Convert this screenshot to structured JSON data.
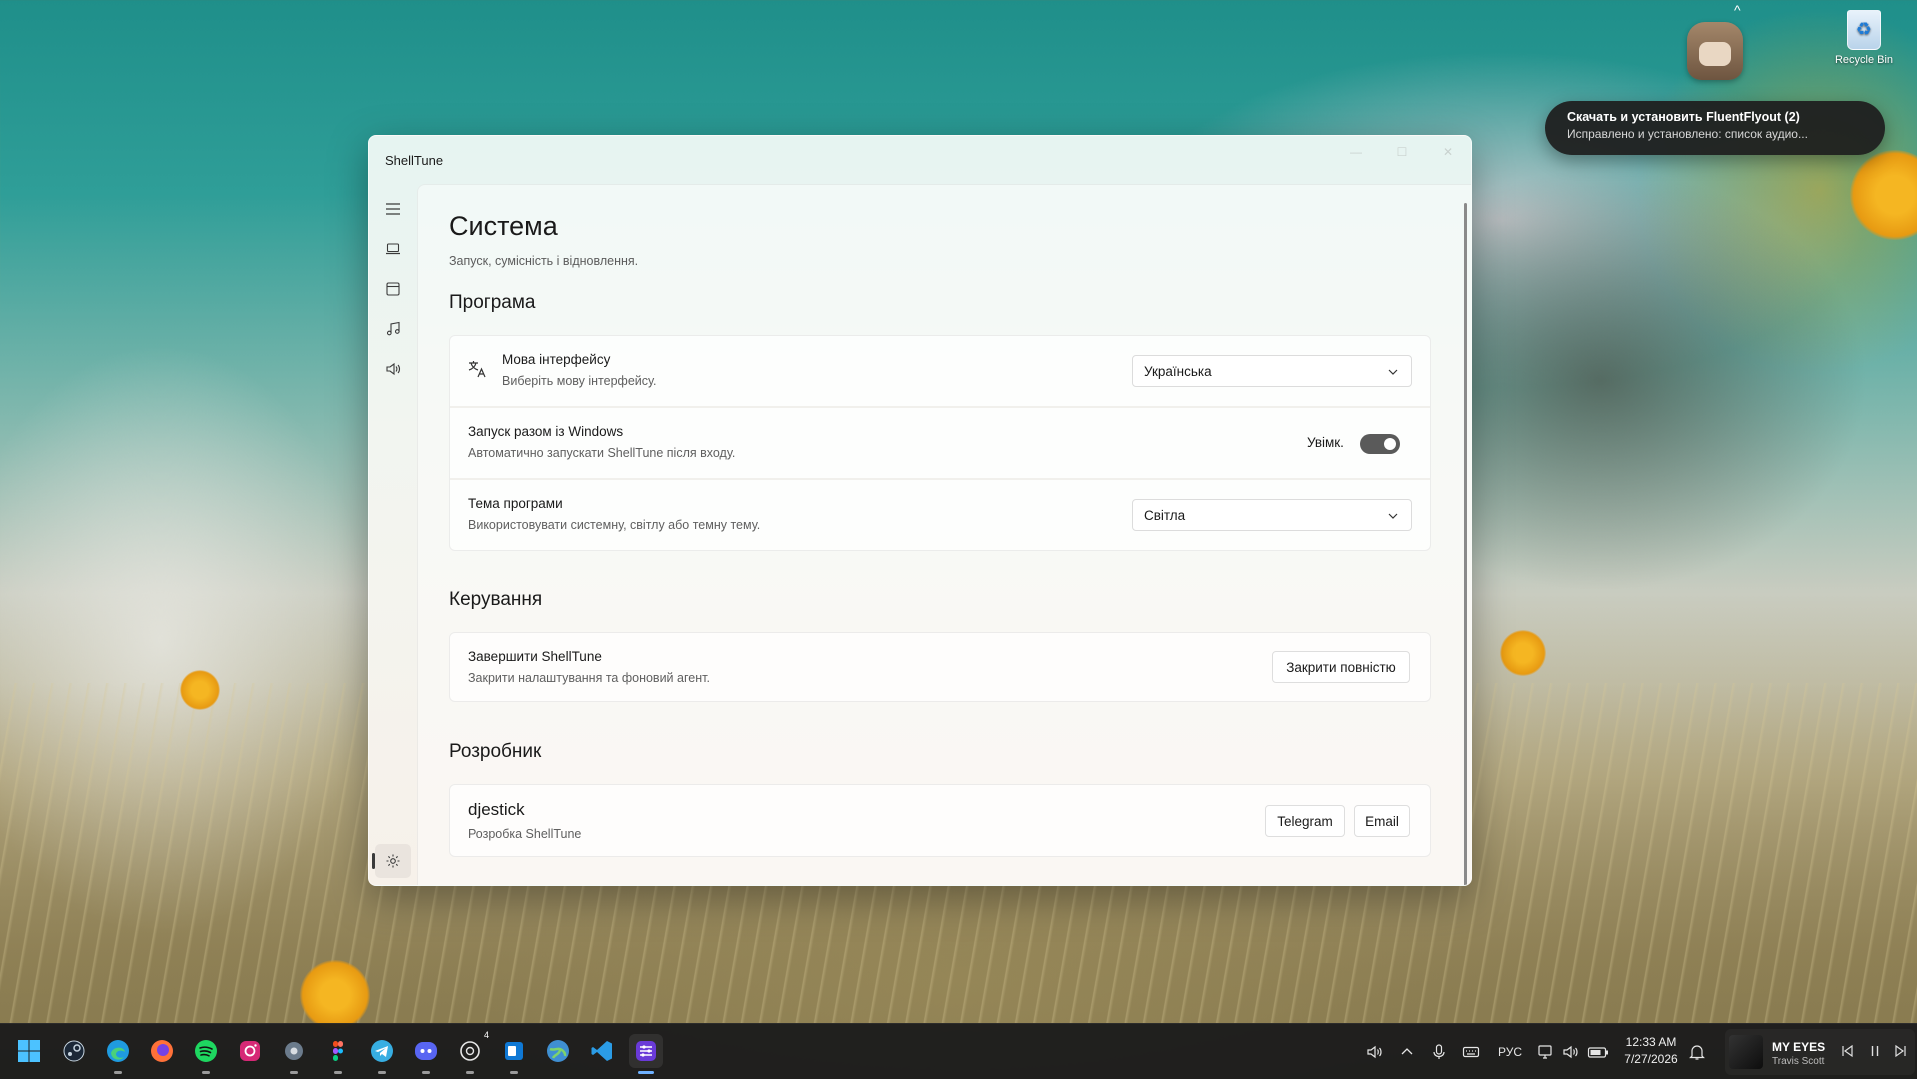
{
  "desktop": {
    "recycle_bin_label": "Recycle Bin",
    "show_hidden_icons_caret": "^"
  },
  "toast": {
    "title": "Скачать и установить FluentFlyout (2)",
    "body": "Исправлено и установлено: список аудио..."
  },
  "window": {
    "title": "ShellTune",
    "controls": {
      "minimize": "—",
      "maximize": "☐",
      "close": "✕"
    }
  },
  "nav": {
    "items": [
      {
        "icon": "hamburger-menu-icon"
      },
      {
        "icon": "laptop-icon"
      },
      {
        "icon": "window-icon"
      },
      {
        "icon": "music-note-icon"
      },
      {
        "icon": "speaker-icon"
      }
    ],
    "footer": {
      "icon": "gear-icon",
      "selected": true
    }
  },
  "page": {
    "title": "Система",
    "subtitle": "Запуск, сумісність і відновлення.",
    "sections": {
      "program": {
        "header": "Програма",
        "language": {
          "title": "Мова інтерфейсу",
          "desc": "Виберіть мову інтерфейсу.",
          "value": "Українська",
          "icon": "translate-icon"
        },
        "startup": {
          "title": "Запуск разом із Windows",
          "desc": "Автоматично запускати ShellTune після входу.",
          "toggle_label": "Увімк.",
          "toggle_on": true
        },
        "theme": {
          "title": "Тема програми",
          "desc": "Використовувати системну, світлу або темну тему.",
          "value": "Світла"
        }
      },
      "control": {
        "header": "Керування",
        "quit": {
          "title": "Завершити ShellTune",
          "desc": "Закрити налаштування та фоновий агент.",
          "button": "Закрити повністю"
        }
      },
      "developer": {
        "header": "Розробник",
        "name": "djestick",
        "desc": "Розробка ShellTune",
        "buttons": {
          "telegram": "Telegram",
          "email": "Email"
        }
      }
    }
  },
  "taskbar": {
    "apps": [
      "start-icon",
      "steam-icon",
      "edge-icon",
      "firefox-icon",
      "spotify-icon",
      "instagram-icon",
      "settings-icon",
      "figma-icon",
      "telegram-icon",
      "discord-icon",
      "chatgpt-icon",
      "outlook-icon",
      "browser-globe-icon",
      "vscode-icon",
      "shelltune-icon"
    ],
    "discord_badge": "4",
    "language": "РУС",
    "time": "12:33 AM",
    "date": "7/27/2026",
    "media": {
      "song": "MY EYES",
      "artist": "Travis Scott"
    }
  },
  "colors": {
    "accent_toggle": "#5a5a5a",
    "taskbar_bg": "#1c1c1c",
    "active_indicator": "#6fb1ff"
  }
}
